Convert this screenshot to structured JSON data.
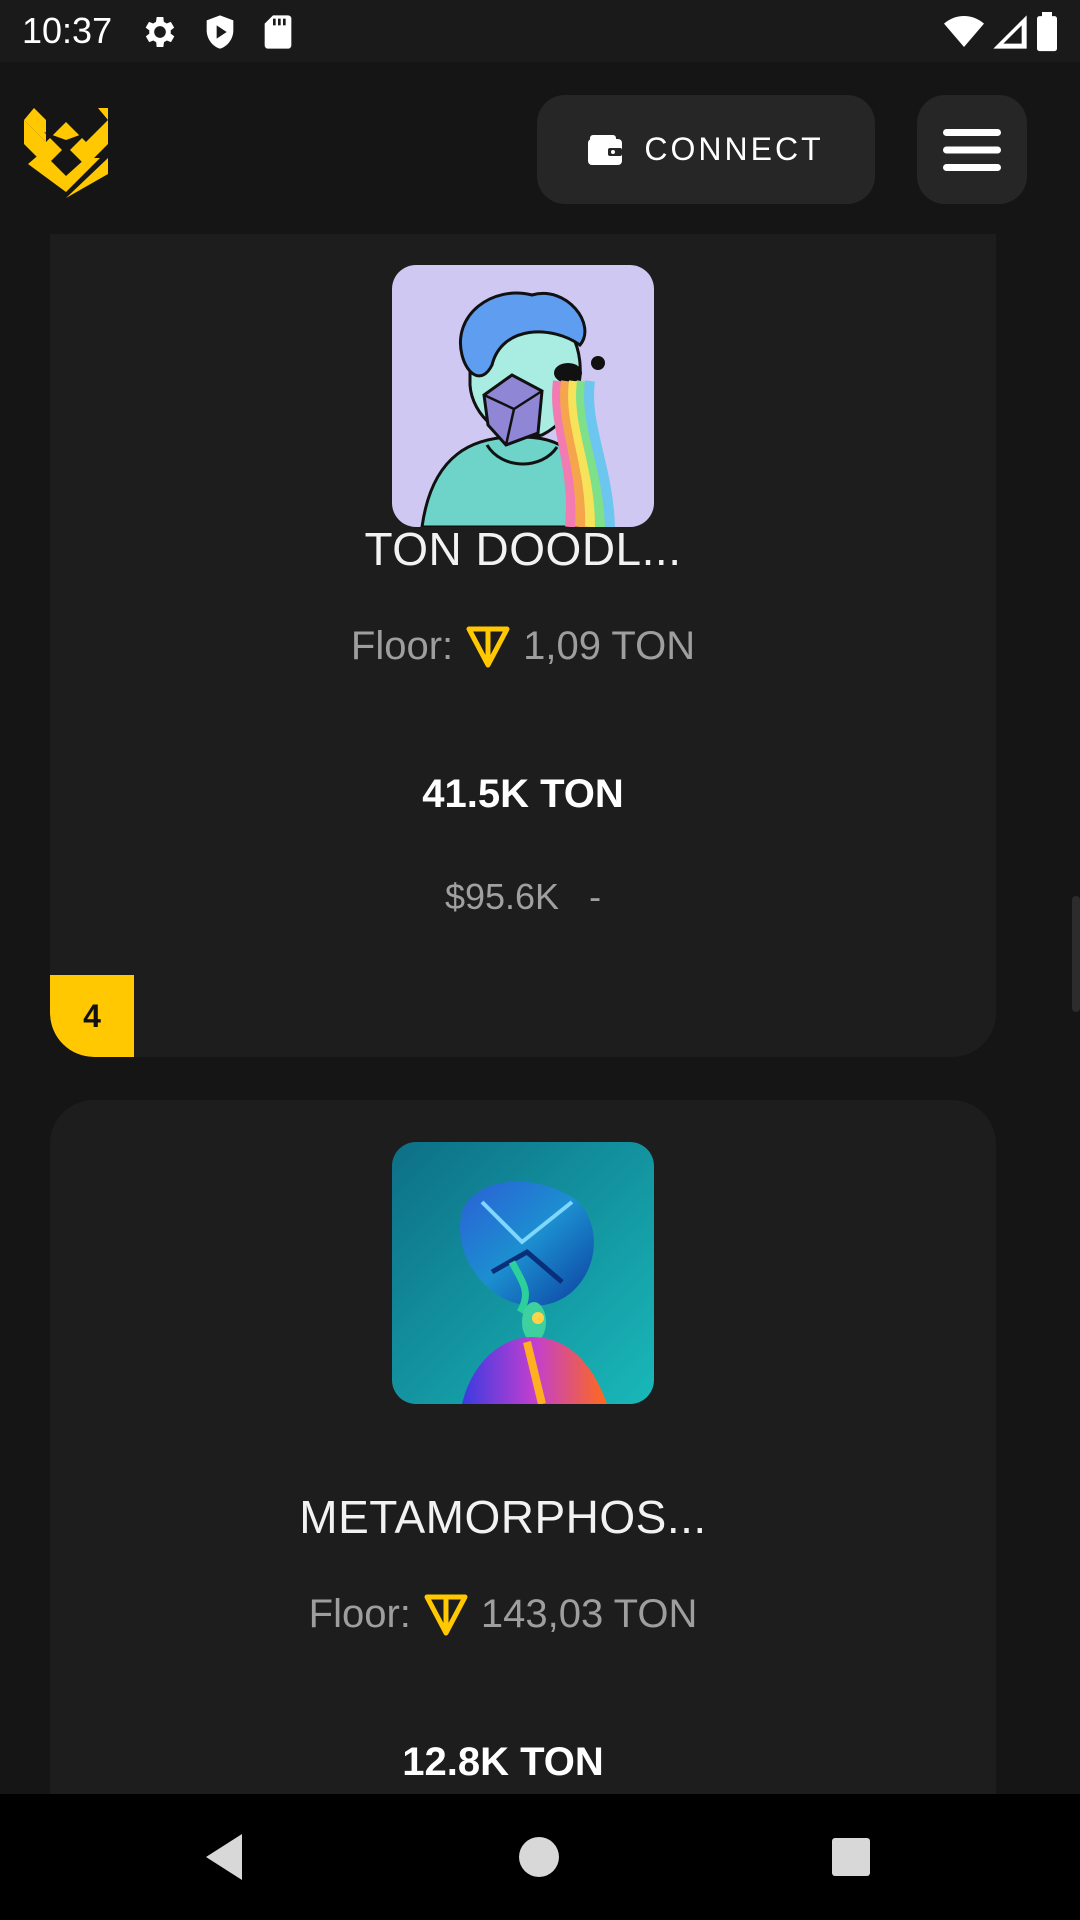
{
  "status_bar": {
    "time": "10:37",
    "icons": [
      "gear-icon",
      "shield-icon",
      "sd-card-icon",
      "wifi-icon",
      "signal-icon",
      "battery-icon"
    ]
  },
  "header": {
    "logo": "getgems-logo",
    "connect_label": "CONNECT",
    "connect_icon": "wallet-icon",
    "menu_icon": "hamburger-menu-icon"
  },
  "collections": [
    {
      "name": "TON DOODL...",
      "floor_label": "Floor:",
      "floor_value": "1,09 TON",
      "volume": "41.5K TON",
      "volume_usd": "$95.6K",
      "change": "-",
      "rank": "4"
    },
    {
      "name": "METAMORPHOS...",
      "floor_label": "Floor:",
      "floor_value": "143,03 TON",
      "volume": "12.8K TON"
    }
  ],
  "nav": {
    "back": "back-icon",
    "home": "home-icon",
    "recents": "recents-icon"
  },
  "colors": {
    "background": "#151515",
    "card": "#1d1d1d",
    "accent": "#ffc800",
    "button": "#262626"
  }
}
